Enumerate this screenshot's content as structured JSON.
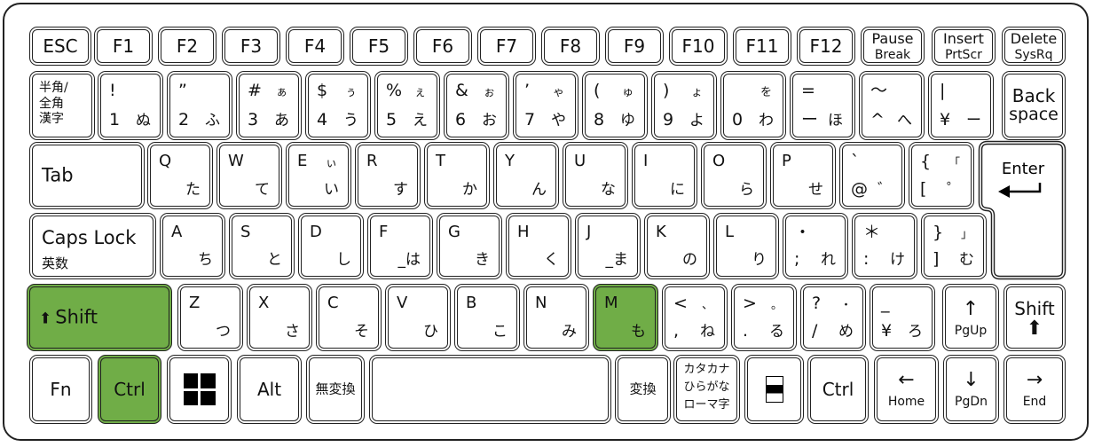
{
  "colors": {
    "highlight": "#70ad47",
    "outline": "#222222"
  },
  "rows": [
    [
      {
        "c": "ESC"
      },
      {
        "c": "F1"
      },
      {
        "c": "F2"
      },
      {
        "c": "F3"
      },
      {
        "c": "F4"
      },
      {
        "c": "F5"
      },
      {
        "c": "F6"
      },
      {
        "c": "F7"
      },
      {
        "c": "F8"
      },
      {
        "c": "F9"
      },
      {
        "c": "F10"
      },
      {
        "c": "F11"
      },
      {
        "c": "F12"
      },
      {
        "top": "Pause",
        "bottom": "Break"
      },
      {
        "top": "Insert",
        "bottom": "PrtScr"
      },
      {
        "top": "Delete",
        "bottom": "SysRq"
      }
    ],
    [
      {
        "lines": "半角/\n全角\n漢字"
      },
      {
        "tl": "!",
        "bl": "1",
        "br": "ぬ"
      },
      {
        "tl": "”",
        "bl": "2",
        "br": "ふ"
      },
      {
        "tl": "#",
        "tr": "ぁ",
        "bl": "3",
        "br": "あ"
      },
      {
        "tl": "$",
        "tr": "ぅ",
        "bl": "4",
        "br": "う"
      },
      {
        "tl": "%",
        "tr": "ぇ",
        "bl": "5",
        "br": "え"
      },
      {
        "tl": "&",
        "tr": "ぉ",
        "bl": "6",
        "br": "お"
      },
      {
        "tl": "’",
        "tr": "ゃ",
        "bl": "7",
        "br": "や"
      },
      {
        "tl": "(",
        "tr": "ゅ",
        "bl": "8",
        "br": "ゆ"
      },
      {
        "tl": ")",
        "tr": "ょ",
        "bl": "9",
        "br": "よ"
      },
      {
        "tr": "を",
        "bl": "0",
        "br": "わ"
      },
      {
        "tl": "=",
        "bl": "ー",
        "br": "ほ"
      },
      {
        "tl": "～",
        "bl": "^",
        "br": "へ"
      },
      {
        "tl": "|",
        "bl": "¥",
        "br": "ー"
      },
      {
        "top": "Back",
        "bottom": "space",
        "big": true
      }
    ],
    [
      {
        "left": "Tab"
      },
      {
        "tl": "Q",
        "br": "た"
      },
      {
        "tl": "W",
        "br": "て"
      },
      {
        "tl": "E",
        "tr": "ぃ",
        "br": "い"
      },
      {
        "tl": "R",
        "br": "す"
      },
      {
        "tl": "T",
        "br": "か"
      },
      {
        "tl": "Y",
        "br": "ん"
      },
      {
        "tl": "U",
        "br": "な"
      },
      {
        "tl": "I",
        "br": "に"
      },
      {
        "tl": "O",
        "br": "ら"
      },
      {
        "tl": "P",
        "br": "せ"
      },
      {
        "tl": "`",
        "bl": "@",
        "br": "゛"
      },
      {
        "tl": "{",
        "tr": "「",
        "bl": "[",
        "br": "゜"
      }
    ],
    [
      {
        "top": "Caps Lock",
        "bottom": "英数",
        "leftAlign": true
      },
      {
        "tl": "A",
        "br": "ち"
      },
      {
        "tl": "S",
        "br": "と"
      },
      {
        "tl": "D",
        "br": "し"
      },
      {
        "tl": "F",
        "br": "_は"
      },
      {
        "tl": "G",
        "br": "き"
      },
      {
        "tl": "H",
        "br": "く"
      },
      {
        "tl": "J",
        "br": "_ま"
      },
      {
        "tl": "K",
        "br": "の"
      },
      {
        "tl": "L",
        "br": "り"
      },
      {
        "tl": "・",
        "bl": ";",
        "br": "れ"
      },
      {
        "tl": "＊",
        "bl": ":",
        "br": "け"
      },
      {
        "tl": "}",
        "tr": "」",
        "bl": "]",
        "br": "む"
      }
    ],
    [
      {
        "left": "Shift",
        "icon": "shift-arrow-icon",
        "iconGlyph": "⬆",
        "highlight": true
      },
      {
        "tl": "Z",
        "br": "つ"
      },
      {
        "tl": "X",
        "br": "さ"
      },
      {
        "tl": "C",
        "br": "そ"
      },
      {
        "tl": "V",
        "br": "ひ"
      },
      {
        "tl": "B",
        "br": "こ"
      },
      {
        "tl": "N",
        "br": "み"
      },
      {
        "tl": "M",
        "br": "も",
        "highlight": true
      },
      {
        "tl": "<",
        "tr": "、",
        "bl": ",",
        "br": "ね"
      },
      {
        "tl": ">",
        "tr": "。",
        "bl": ".",
        "br": "る"
      },
      {
        "tl": "?",
        "tr": "・",
        "bl": "/",
        "br": "め"
      },
      {
        "tl": "_",
        "bl": "¥",
        "br": "ろ"
      },
      {
        "top": "↑",
        "bottom": "PgUp",
        "icon": "arrow-up-icon"
      },
      {
        "top": "Shift",
        "bottom": "⬆",
        "icon": "shift-arrow-icon",
        "big": true
      }
    ],
    [
      {
        "c": "Fn"
      },
      {
        "c": "Ctrl",
        "highlight": true
      },
      {
        "win": true,
        "icon": "windows-logo-icon"
      },
      {
        "c": "Alt"
      },
      {
        "c": "無変換",
        "smallc": true
      },
      {
        "c": ""
      },
      {
        "c": "変換",
        "smallc": true
      },
      {
        "three": "カタカナ\nひらがな\nローマ字"
      },
      {
        "menu": true,
        "icon": "menu-icon"
      },
      {
        "c": "Ctrl"
      },
      {
        "top": "←",
        "bottom": "Home",
        "icon": "arrow-left-icon"
      },
      {
        "top": "↓",
        "bottom": "PgDn",
        "icon": "arrow-down-icon"
      },
      {
        "top": "→",
        "bottom": "End",
        "icon": "arrow-right-icon"
      }
    ]
  ],
  "enter": {
    "label": "Enter",
    "glyph": "↵"
  }
}
